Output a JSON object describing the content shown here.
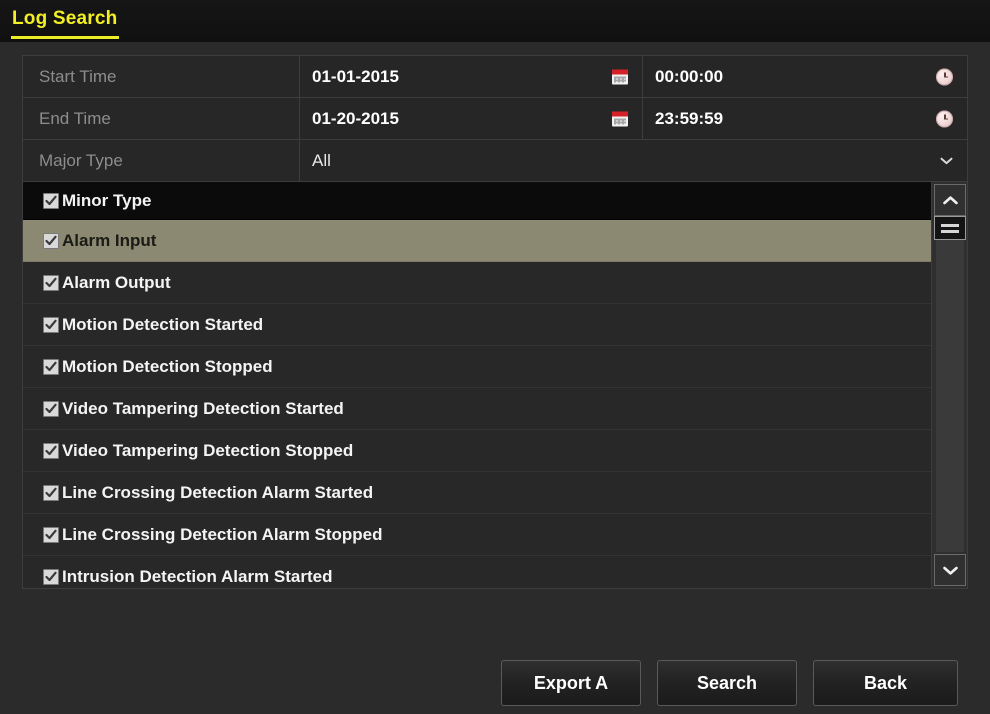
{
  "window": {
    "title": "Log Search"
  },
  "form": {
    "rows": [
      {
        "label": "Start Time",
        "date": "01-01-2015",
        "date_icon": "calendar-icon",
        "time": "00:00:00",
        "time_icon": "clock-icon"
      },
      {
        "label": "End Time",
        "date": "01-20-2015",
        "date_icon": "calendar-icon",
        "time": "23:59:59",
        "time_icon": "clock-icon"
      }
    ],
    "major_type": {
      "label": "Major Type",
      "value": "All",
      "icon": "chevron-down-icon"
    }
  },
  "minor_type_list": {
    "header": {
      "label": "Minor Type",
      "checked": true
    },
    "items": [
      {
        "label": "Alarm Input",
        "checked": true,
        "selected": true
      },
      {
        "label": "Alarm Output",
        "checked": true,
        "selected": false
      },
      {
        "label": "Motion Detection Started",
        "checked": true,
        "selected": false
      },
      {
        "label": "Motion Detection Stopped",
        "checked": true,
        "selected": false
      },
      {
        "label": "Video Tampering Detection Started",
        "checked": true,
        "selected": false
      },
      {
        "label": "Video Tampering Detection Stopped",
        "checked": true,
        "selected": false
      },
      {
        "label": "Line Crossing Detection Alarm Started",
        "checked": true,
        "selected": false
      },
      {
        "label": "Line Crossing Detection Alarm Stopped",
        "checked": true,
        "selected": false
      },
      {
        "label": "Intrusion Detection Alarm Started",
        "checked": true,
        "selected": false
      }
    ],
    "scrollbar": {
      "up_icon": "chevron-up-icon",
      "down_icon": "chevron-down-icon",
      "thumb_icon": "scroll-thumb-grip"
    }
  },
  "footer": {
    "export_label": "Export A",
    "search_label": "Search",
    "back_label": "Back"
  },
  "colors": {
    "accent": "#eded26",
    "selection": "#8b8972",
    "panel_bg": "#2b2b2b",
    "header_bg": "#0b0b0b",
    "calendar_red": "#d62128"
  }
}
